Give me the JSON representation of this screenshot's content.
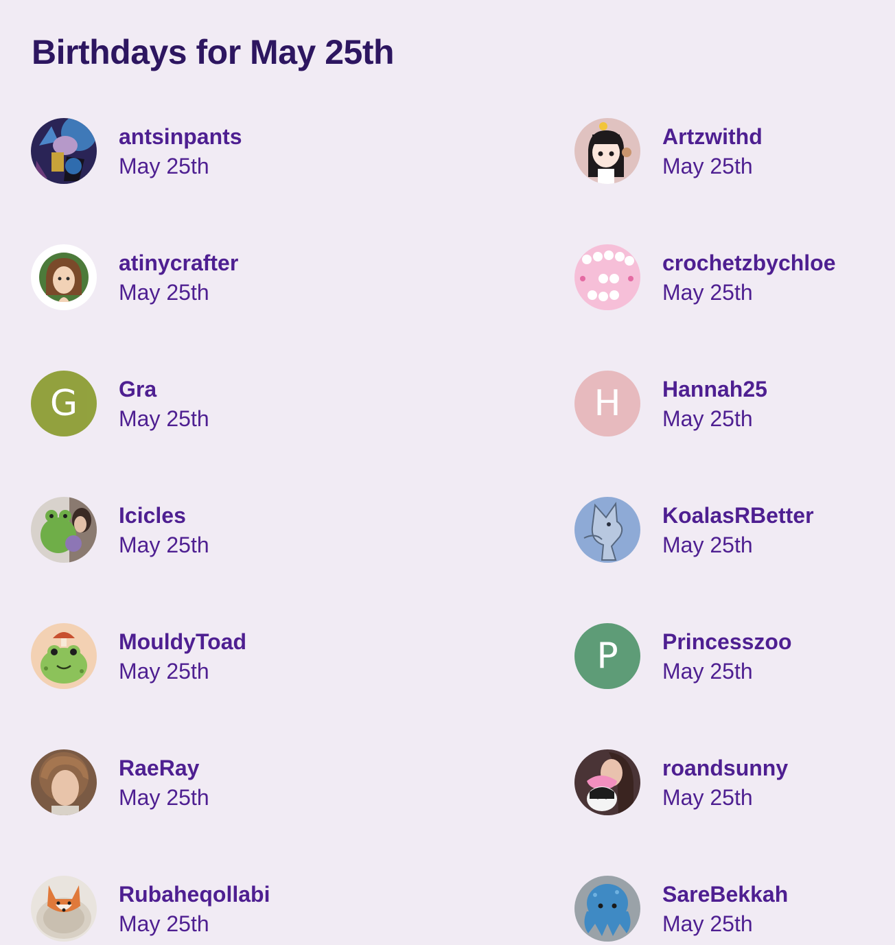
{
  "page": {
    "title": "Birthdays for May 25th"
  },
  "people": [
    {
      "name": "antsinpants",
      "date": "May 25th",
      "avatar": "photo"
    },
    {
      "name": "Artzwithd",
      "date": "May 25th",
      "avatar": "photo"
    },
    {
      "name": "atinycrafter",
      "date": "May 25th",
      "avatar": "photo"
    },
    {
      "name": "crochetzbychloe",
      "date": "May 25th",
      "avatar": "photo"
    },
    {
      "name": "Gra",
      "date": "May 25th",
      "avatar": "letter",
      "letter": "G",
      "color": "#8a9b2e"
    },
    {
      "name": "Hannah25",
      "date": "May 25th",
      "avatar": "letter",
      "letter": "H",
      "color": "#e6b6b9"
    },
    {
      "name": "Icicles",
      "date": "May 25th",
      "avatar": "photo"
    },
    {
      "name": "KoalasRBetter",
      "date": "May 25th",
      "avatar": "photo"
    },
    {
      "name": "MouldyToad",
      "date": "May 25th",
      "avatar": "photo"
    },
    {
      "name": "Princesszoo",
      "date": "May 25th",
      "avatar": "letter",
      "letter": "P",
      "color": "#52956c"
    },
    {
      "name": "RaeRay",
      "date": "May 25th",
      "avatar": "photo"
    },
    {
      "name": "roandsunny",
      "date": "May 25th",
      "avatar": "photo"
    },
    {
      "name": "Rubaheqollabi",
      "date": "May 25th",
      "avatar": "photo"
    },
    {
      "name": "SareBekkah",
      "date": "May 25th",
      "avatar": "photo"
    }
  ],
  "theme": {
    "background": "#f1ebf4",
    "title_color": "#2d1660",
    "text_color": "#4e1f91"
  }
}
